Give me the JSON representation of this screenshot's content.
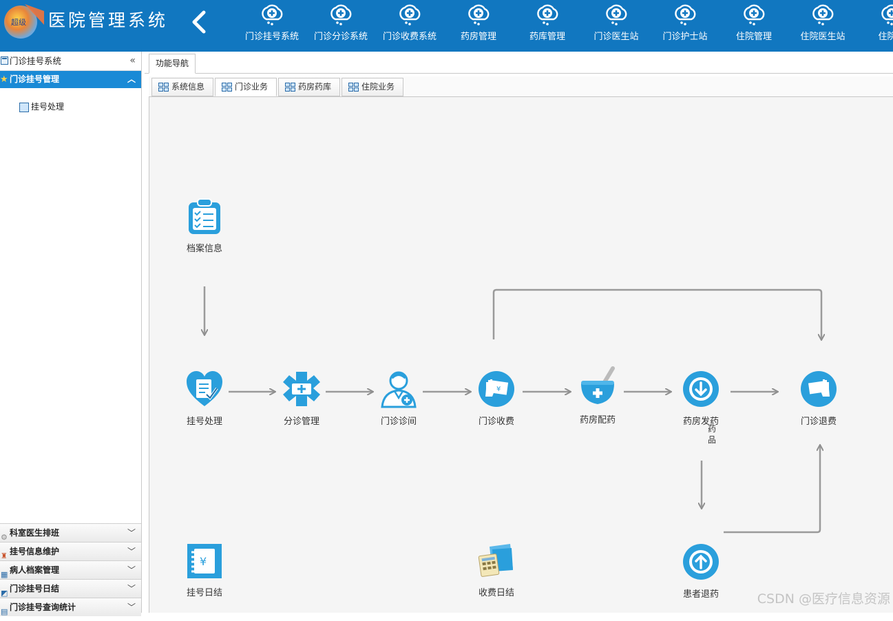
{
  "header": {
    "title": "医院管理系统",
    "logo_text": "超级",
    "modules": [
      {
        "label": "门诊挂号系统"
      },
      {
        "label": "门诊分诊系统"
      },
      {
        "label": "门诊收费系统"
      },
      {
        "label": "药房管理"
      },
      {
        "label": "药库管理"
      },
      {
        "label": "门诊医生站"
      },
      {
        "label": "门诊护士站"
      },
      {
        "label": "住院管理"
      },
      {
        "label": "住院医生站"
      },
      {
        "label": "住院护"
      }
    ]
  },
  "sidebar": {
    "title": "门诊挂号系统",
    "collapse_glyph": "«",
    "active_group": "门诊挂号管理",
    "active_item": "挂号处理",
    "groups": [
      {
        "label": "科室医生排班"
      },
      {
        "label": "挂号信息维护"
      },
      {
        "label": "病人档案管理"
      },
      {
        "label": "门诊挂号日结"
      },
      {
        "label": "门诊挂号查询统计"
      }
    ]
  },
  "main": {
    "tab": "功能导航",
    "subtabs": [
      {
        "label": "系统信息"
      },
      {
        "label": "门诊业务"
      },
      {
        "label": "药房药库"
      },
      {
        "label": "住院业务"
      }
    ],
    "active_subtab": 1,
    "nodes": {
      "archive": "档案信息",
      "register": "挂号处理",
      "triage": "分诊管理",
      "consult": "门诊诊间",
      "charge": "门诊收费",
      "dispense": "药房配药",
      "issue": "药房发药",
      "refund": "门诊退费",
      "reg_daily": "挂号日结",
      "charge_daily": "收费日结",
      "return_drug": "患者退药"
    },
    "drug_label": "药品"
  },
  "watermark": "CSDN @医疗信息资源",
  "colors": {
    "header": "#1177c0",
    "accent": "#1a8ad6",
    "icon": "#2a9fdc"
  }
}
